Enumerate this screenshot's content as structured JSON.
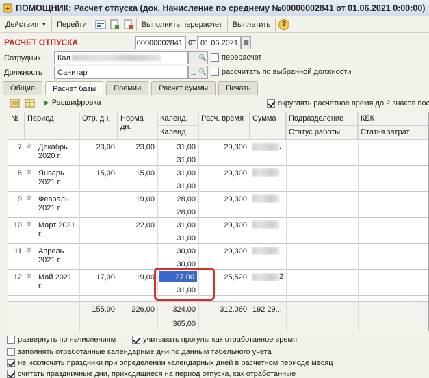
{
  "window": {
    "title": "ПОМОЩНИК: Расчет отпуска (док. Начисление по среднему №00000002841 от 01.06.2021 0:00:00)"
  },
  "toolbar": {
    "actions": "Действия",
    "goto": "Перейти",
    "recalc": "Выполнить перерасчет",
    "pay": "Выплатить",
    "help": "?"
  },
  "header": {
    "heading": "РАСЧЕТ ОТПУСКА",
    "number": "00000002841",
    "from_label": "от",
    "date": "01.06.2021",
    "employee_label": "Сотрудник",
    "employee_value": "Кал",
    "position_label": "Должность",
    "position_value": "Санитар",
    "recalc_label": "перерасчет",
    "by_position_label": "рассчитать по выбранной должности"
  },
  "tabs": [
    "Общие",
    "Расчет базы",
    "Премии",
    "Расчет суммы",
    "Печать"
  ],
  "grid_toolbar": {
    "decode": "Расшифровка",
    "round_label": "округлять расчетное время до 2 знаков пос"
  },
  "columns": {
    "no": "№",
    "period": "Период",
    "work_days": "Отр. дн.",
    "norm_days": "Норма дн.",
    "cal1": "Календ. ...",
    "cal2": "Календ. ...",
    "calc_time": "Расч. время",
    "sum": "Сумма",
    "dept": "Подразделение",
    "work_status": "Статус работы",
    "kbk": "КБК",
    "cost_item": "Статья затрат"
  },
  "rows": [
    {
      "no": "7",
      "period": "Декабрь 2020 г.",
      "work": "23,00",
      "norm": "23,00",
      "cal1": "31,00",
      "cal2": "31,00",
      "time": "29,300",
      "sum_tail": "."
    },
    {
      "no": "8",
      "period": "Январь 2021 г.",
      "work": "15,00",
      "norm": "15,00",
      "cal1": "31,00",
      "cal2": "31,00",
      "time": "29,300",
      "sum_tail": ""
    },
    {
      "no": "9",
      "period": "Февраль 2021 г.",
      "work": "",
      "norm": "19,00",
      "cal1": "28,00",
      "cal2": "28,00",
      "time": "29,300",
      "sum_tail": ""
    },
    {
      "no": "10",
      "period": "Март 2021 г.",
      "work": "",
      "norm": "22,00",
      "cal1": "31,00",
      "cal2": "31,00",
      "time": "29,300",
      "sum_tail": ""
    },
    {
      "no": "11",
      "period": "Апрель 2021 г.",
      "work": "",
      "norm": "",
      "cal1": "30,00",
      "cal2": "30,00",
      "time": "29,300",
      "sum_tail": ""
    },
    {
      "no": "12",
      "period": "Май 2021 г.",
      "work": "17,00",
      "norm": "19,00",
      "cal1": "27,00",
      "cal2": "31,00",
      "time": "25,520",
      "sum_tail": "2"
    }
  ],
  "totals": {
    "work": "155,00",
    "norm": "226,00",
    "cal1": "324,00",
    "cal2": "365,00",
    "time": "312,060",
    "sum": "192 29..."
  },
  "options": {
    "expand": "развернуть по начислениям",
    "absences": "учитывать прогулы как отработанное время",
    "fill_days": "заполнять отработанные календарные дни по данным табельного учета",
    "holidays": "не исключать праздники при определении календарных дней в расчетном периоде  месяц",
    "holidays_worked": "считать праздничные дни, приходящиеся на период отпуска, как отработанные"
  }
}
